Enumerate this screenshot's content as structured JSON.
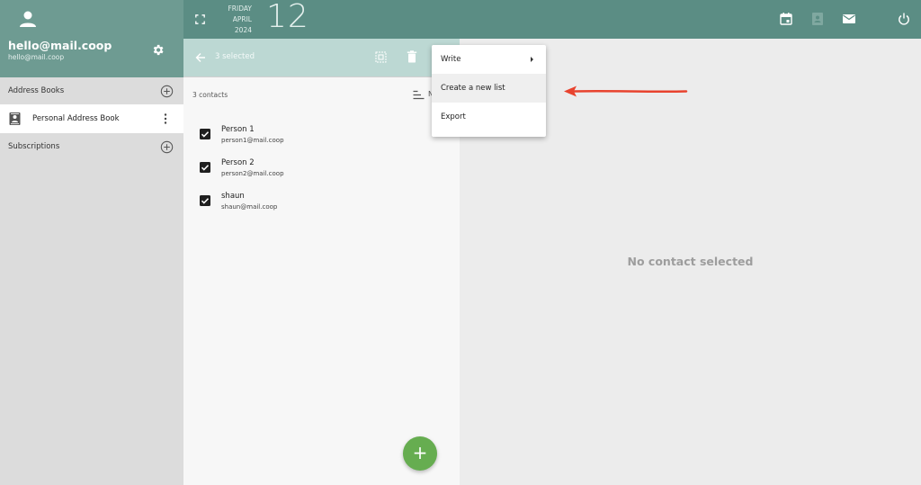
{
  "user": {
    "name": "hello@mail.coop",
    "email": "hello@mail.coop"
  },
  "sidebar": {
    "address_books_label": "Address Books",
    "address_book_item": "Personal Address Book",
    "subscriptions_label": "Subscriptions"
  },
  "topbar": {
    "weekday": "FRIDAY",
    "month": "APRIL",
    "year": "2024",
    "day": "12"
  },
  "selection": {
    "count_label": "3 selected"
  },
  "list": {
    "count_label": "3 contacts",
    "sort_letter": "N",
    "contacts": [
      {
        "name": "Person 1",
        "email": "person1@mail.coop",
        "checked": true
      },
      {
        "name": "Person 2",
        "email": "person2@mail.coop",
        "checked": true
      },
      {
        "name": "shaun",
        "email": "shaun@mail.coop",
        "checked": true
      }
    ],
    "fab_label": "+"
  },
  "menu": {
    "items": [
      {
        "label": "Write",
        "submenu": true
      },
      {
        "label": "Create a new list",
        "highlighted": true
      },
      {
        "label": "Export"
      }
    ]
  },
  "detail": {
    "empty_text": "No contact selected"
  },
  "colors": {
    "topbar": "#5b8d84",
    "user_panel": "#6e9b92",
    "selection_bar": "#bcd8d3",
    "fab": "#66ad50",
    "annotation_arrow": "#e8432e"
  }
}
